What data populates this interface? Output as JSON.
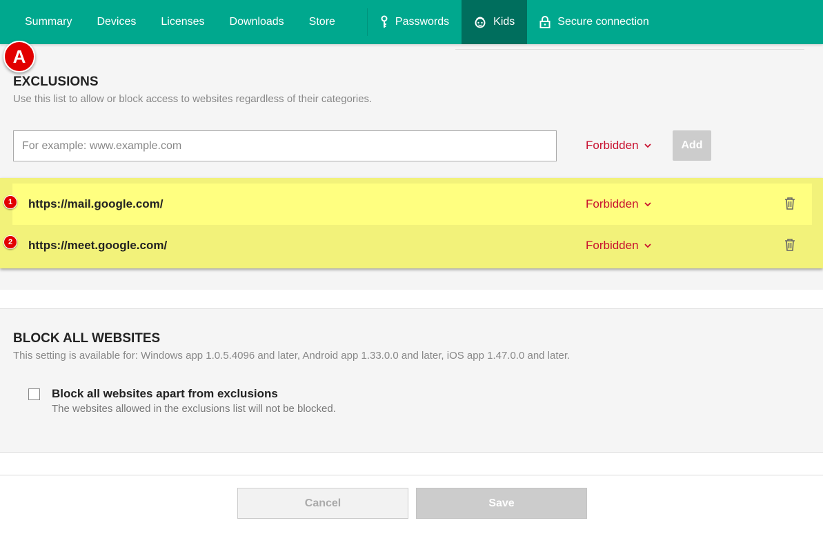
{
  "nav": {
    "items": [
      {
        "label": "Summary"
      },
      {
        "label": "Devices"
      },
      {
        "label": "Licenses"
      },
      {
        "label": "Downloads"
      },
      {
        "label": "Store"
      }
    ],
    "right_items": [
      {
        "label": "Passwords",
        "icon": "key-icon"
      },
      {
        "label": "Kids",
        "icon": "kids-face-icon",
        "active": true
      },
      {
        "label": "Secure connection",
        "icon": "lock-icon"
      }
    ],
    "color": "#00a88e",
    "active_color": "#006e5d"
  },
  "annotation_badge": "A",
  "exclusions": {
    "title": "EXCLUSIONS",
    "subtitle": "Use this list to allow or block access to websites regardless of their categories.",
    "input_placeholder": "For example: www.example.com",
    "input_value": "",
    "new_mode": "Forbidden",
    "add_label": "Add",
    "rows": [
      {
        "badge": "1",
        "url": "https://mail.google.com/",
        "mode": "Forbidden"
      },
      {
        "badge": "2",
        "url": "https://meet.google.com/",
        "mode": "Forbidden"
      }
    ],
    "highlight_color": "#ffff80"
  },
  "block_all": {
    "title": "BLOCK ALL WEBSITES",
    "subtitle": "This setting is available for: Windows app 1.0.5.4096 and later, Android app 1.33.0.0 and later, iOS app 1.47.0.0 and later.",
    "checkbox_label": "Block all websites apart from exclusions",
    "checkbox_sub": "The websites allowed in the exclusions list will not be blocked.",
    "checked": false
  },
  "footer": {
    "cancel_label": "Cancel",
    "save_label": "Save"
  },
  "accent_red": "#c8102e"
}
